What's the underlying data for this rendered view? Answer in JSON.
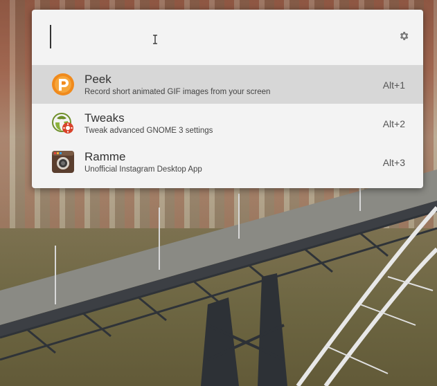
{
  "launcher": {
    "query": "",
    "settings_icon": "gear-icon",
    "results": [
      {
        "name": "Peek",
        "description": "Record short animated GIF images from your screen",
        "shortcut": "Alt+1",
        "icon": "peek-icon",
        "selected": true
      },
      {
        "name": "Tweaks",
        "description": "Tweak advanced GNOME 3 settings",
        "shortcut": "Alt+2",
        "icon": "tweaks-icon",
        "selected": false
      },
      {
        "name": "Ramme",
        "description": "Unofficial Instagram Desktop App",
        "shortcut": "Alt+3",
        "icon": "ramme-icon",
        "selected": false
      }
    ]
  },
  "colors": {
    "window_bg": "#f3f3f3",
    "selected_row": "#d7d7d7",
    "peek_orange": "#f08a1c",
    "tweaks_green": "#6e8f2a",
    "tweaks_red": "#d9432b",
    "ramme_brown": "#5a3e2e"
  }
}
